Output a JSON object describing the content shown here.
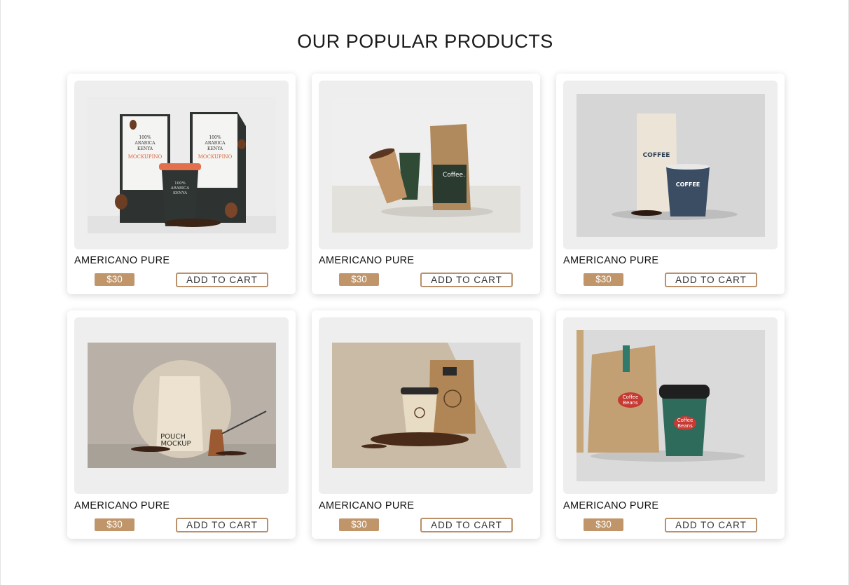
{
  "section": {
    "title": "OUR POPULAR PRODUCTS"
  },
  "products": [
    {
      "name": "AMERICANO PURE",
      "price": "$30",
      "cta": "ADD TO CART",
      "image": "coffee-bags-kenya-cup-photo"
    },
    {
      "name": "AMERICANO PURE",
      "price": "$30",
      "cta": "ADD TO CART",
      "image": "kraft-coffee-bag-and-cups-photo"
    },
    {
      "name": "AMERICANO PURE",
      "price": "$30",
      "cta": "ADD TO CART",
      "image": "coffee-pouch-and-blue-cup-photo"
    },
    {
      "name": "AMERICANO PURE",
      "price": "$30",
      "cta": "ADD TO CART",
      "image": "pouch-mockup-with-cezve-photo"
    },
    {
      "name": "AMERICANO PURE",
      "price": "$30",
      "cta": "ADD TO CART",
      "image": "paper-bag-and-cup-with-beans-photo"
    },
    {
      "name": "AMERICANO PURE",
      "price": "$30",
      "cta": "ADD TO CART",
      "image": "coffee-beans-bag-and-green-cup-photo"
    }
  ],
  "images": {
    "p1": {
      "bag_line1": "100%",
      "bag_line2": "ARABICA",
      "bag_line3": "KENYA",
      "brand": "MOCKUPINO"
    },
    "p2": {
      "bag_label": "Coffee."
    },
    "p3": {
      "bag_label": "COFFEE",
      "cup_label": "COFFEE"
    },
    "p4": {
      "bag_label1": "POUCH",
      "bag_label2": "MOCKUP"
    },
    "p6": {
      "bag_label1": "Coffee",
      "bag_label2": "Beans",
      "cup_label1": "Coffee",
      "cup_label2": "Beans"
    }
  },
  "colors": {
    "accent": "#c0956a",
    "button_border": "#b8916a"
  }
}
